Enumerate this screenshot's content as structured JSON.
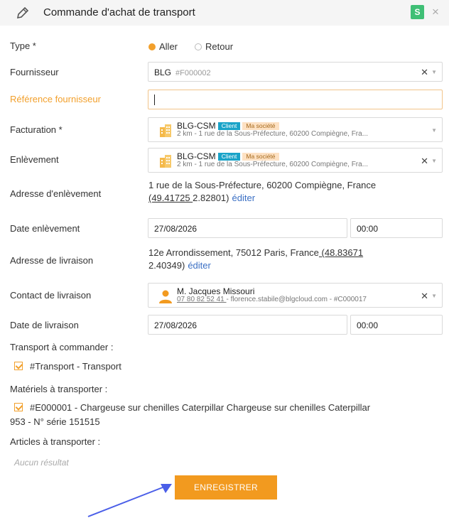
{
  "header": {
    "title": "Commande d'achat de transport",
    "badge": "S",
    "close": "×"
  },
  "form": {
    "type": {
      "label": "Type *",
      "options": [
        "Aller",
        "Retour"
      ],
      "selected": "Aller"
    },
    "fournisseur": {
      "label": "Fournisseur",
      "value": "BLG",
      "code": "#F000002"
    },
    "reference": {
      "label": "Référence fournisseur",
      "value": ""
    },
    "facturation": {
      "label": "Facturation *",
      "name": "BLG-CSM",
      "tag_client": "Client",
      "tag_societe": "Ma société",
      "address": "2 km - 1 rue de la Sous-Préfecture, 60200 Compiègne, Fra..."
    },
    "enlevement": {
      "label": "Enlèvement",
      "name": "BLG-CSM",
      "tag_client": "Client",
      "tag_societe": "Ma société",
      "address": "2 km - 1 rue de la Sous-Préfecture, 60200 Compiègne, Fra..."
    },
    "adresse_enlevement": {
      "label": "Adresse d'enlèvement",
      "address": "1 rue de la Sous-Préfecture, 60200 Compiègne, France",
      "lat": "(49.41725 ",
      "lon": "2.82801)",
      "edit": "éditer"
    },
    "date_enlevement": {
      "label": "Date enlèvement",
      "date": "27/08/2026",
      "time": "00:00"
    },
    "adresse_livraison": {
      "label": "Adresse de livraison",
      "address": "12e Arrondissement, 75012 Paris, France",
      "lat": " (48.83671",
      "lon": "2.40349)",
      "edit": "éditer"
    },
    "contact_livraison": {
      "label": "Contact de livraison",
      "name": "M. Jacques Missouri",
      "phone": "07 80 82 52 41 ",
      "details": "- florence.stabile@blgcloud.com - #C000017"
    },
    "date_livraison": {
      "label": "Date de livraison",
      "date": "27/08/2026",
      "time": "00:00"
    }
  },
  "transport": {
    "heading": "Transport à commander :",
    "item": "#Transport - Transport"
  },
  "materiels": {
    "heading": "Matériels à transporter :",
    "item_line1": "#E000001 - Chargeuse sur chenilles Caterpillar Chargeuse sur chenilles Caterpillar",
    "item_line2": "953 - N° série 151515"
  },
  "articles": {
    "heading": "Articles à transporter :",
    "empty": "Aucun résultat"
  },
  "save_label": "ENREGISTRER",
  "colors": {
    "accent": "#f29a1f",
    "badge": "#3fbf75",
    "link": "#3a6fc4",
    "arrow": "#4a5ee8"
  }
}
